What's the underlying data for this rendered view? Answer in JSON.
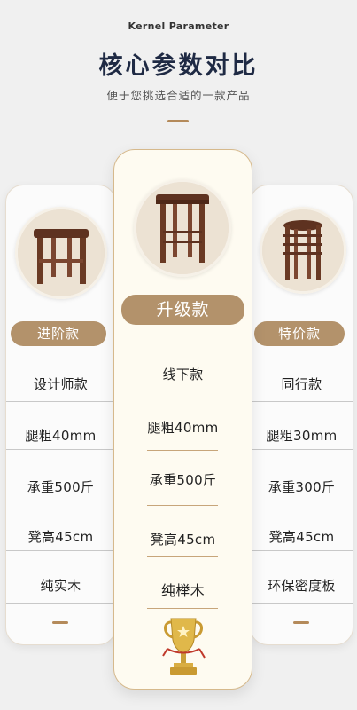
{
  "header": {
    "kernel_parameter": "Kernel Parameter",
    "title": "核心参数对比",
    "subtitle": "便于您挑选合适的一款产品"
  },
  "products": [
    {
      "badge": "进阶款",
      "specs": [
        "设计师款",
        "腿粗40mm",
        "承重500斤",
        "凳高45cm",
        "纯实木"
      ]
    },
    {
      "badge": "升级款",
      "specs": [
        "线下款",
        "腿粗40mm",
        "承重500斤",
        "凳高45cm",
        "纯榉木"
      ]
    },
    {
      "badge": "特价款",
      "specs": [
        "同行款",
        "腿粗30mm",
        "承重300斤",
        "凳高45cm",
        "环保密度板"
      ]
    }
  ],
  "colors": {
    "accent": "#b3926b",
    "title": "#1f2a44",
    "wood": "#6a3a24"
  },
  "icons": [
    "stool-image",
    "stacked-stools-image",
    "trophy-icon"
  ]
}
